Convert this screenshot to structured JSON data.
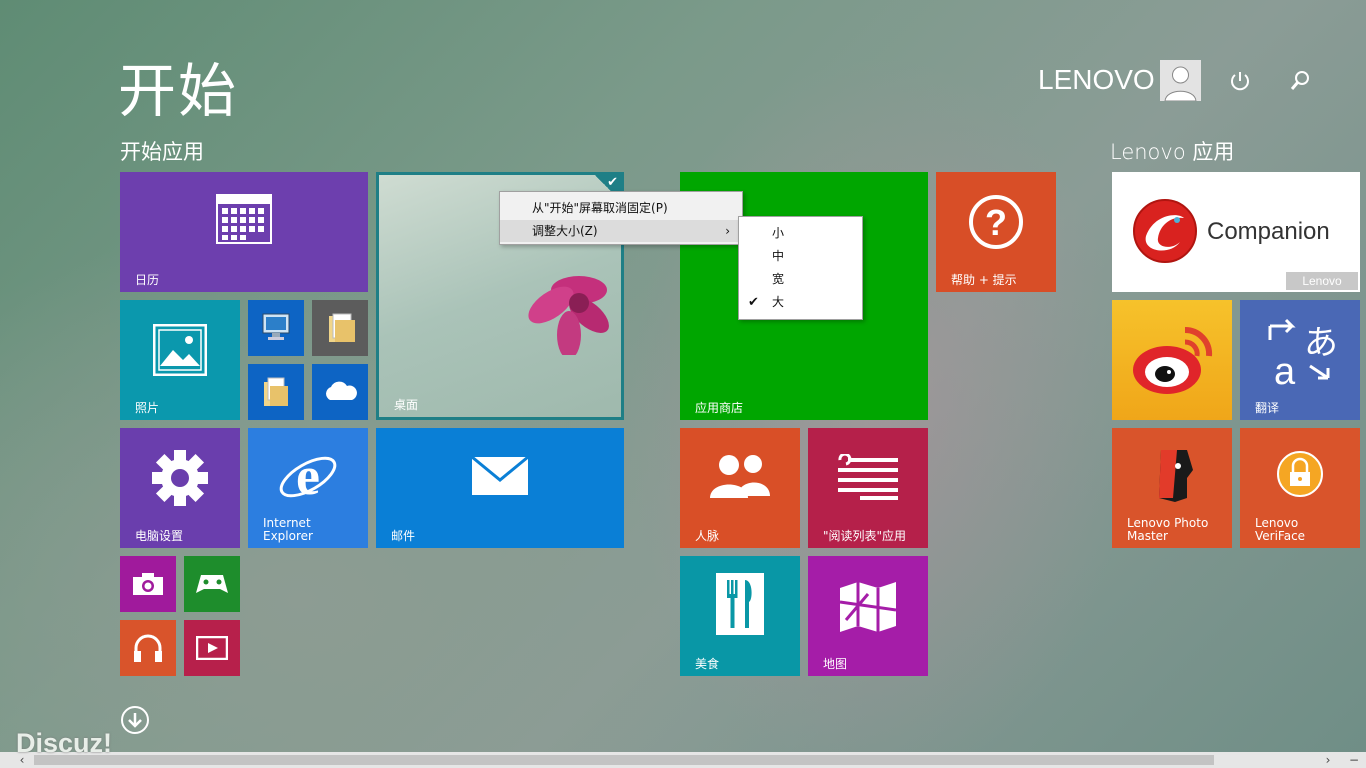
{
  "header": {
    "title": "开始",
    "user_name": "LENOVO"
  },
  "groups": {
    "start_apps": "开始应用",
    "lenovo_apps": "Lenovo 应用"
  },
  "tiles": {
    "calendar": "日历",
    "photos": "照片",
    "desktop": "桌面",
    "store": "应用商店",
    "help": "帮助 + 提示",
    "settings": "电脑设置",
    "ie": "Internet\nExplorer",
    "mail": "邮件",
    "people": "人脉",
    "reading_list": "\"阅读列表\"应用",
    "food": "美食",
    "maps": "地图",
    "companion": "Companion",
    "companion_brand": "Lenovo",
    "translate": "翻译",
    "photo_master": "Lenovo Photo\nMaster",
    "veriface": "Lenovo\nVeriFace"
  },
  "context_menu": {
    "unpin": "从\"开始\"屏幕取消固定(P)",
    "resize": "调整大小(Z)"
  },
  "resize_menu": {
    "options": [
      "小",
      "中",
      "宽",
      "大"
    ],
    "selected": "大"
  },
  "watermark": "Discuz!",
  "colors": {
    "calendar": "#6d3fae",
    "photos": "#0b98ad",
    "desktop": "#1f7f86",
    "store": "#00a600",
    "help": "#d84e27",
    "settings": "#6a3ead",
    "ie": "#2c7ee0",
    "mail": "#0a7fd6",
    "people": "#d94f27",
    "reading_list": "#b5204a",
    "food": "#0997a6",
    "maps": "#a51da8",
    "translate": "#4a68b5",
    "photo_master": "#d9542b",
    "veriface": "#d9542b"
  }
}
